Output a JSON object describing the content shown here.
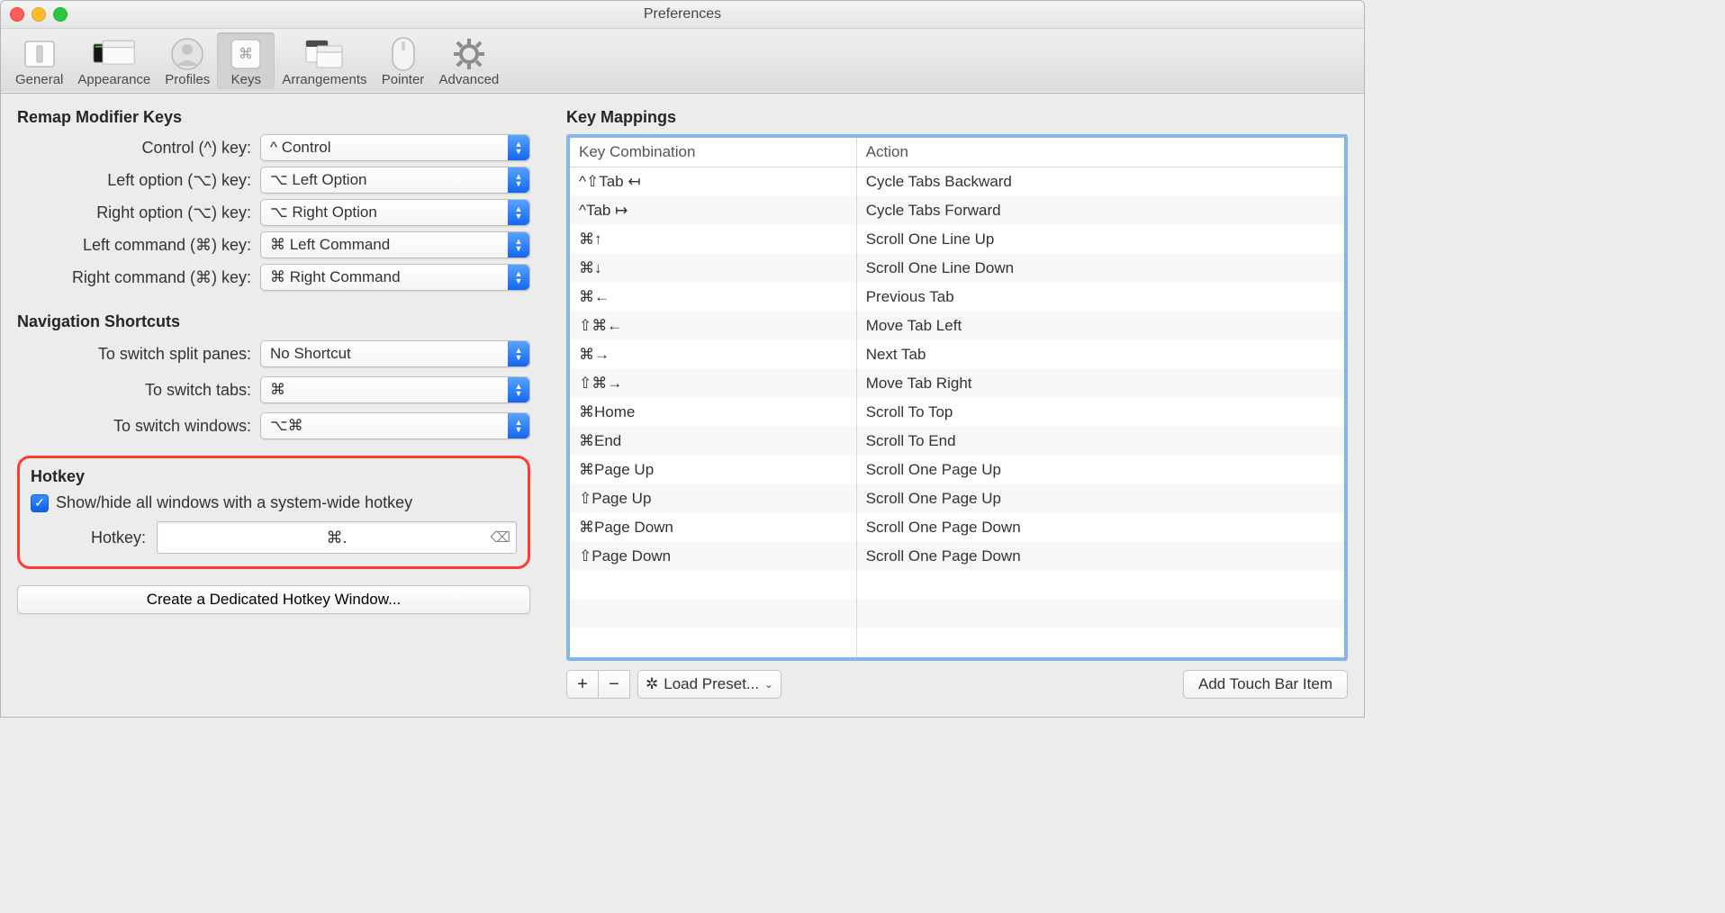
{
  "window": {
    "title": "Preferences"
  },
  "toolbar": {
    "items": [
      {
        "label": "General"
      },
      {
        "label": "Appearance"
      },
      {
        "label": "Profiles"
      },
      {
        "label": "Keys"
      },
      {
        "label": "Arrangements"
      },
      {
        "label": "Pointer"
      },
      {
        "label": "Advanced"
      }
    ],
    "selected_index": 3
  },
  "remap": {
    "title": "Remap Modifier Keys",
    "rows": [
      {
        "label": "Control (^) key:",
        "value": "^ Control"
      },
      {
        "label": "Left option (⌥) key:",
        "value": "⌥ Left Option"
      },
      {
        "label": "Right option (⌥) key:",
        "value": "⌥ Right Option"
      },
      {
        "label": "Left command (⌘) key:",
        "value": "⌘ Left Command"
      },
      {
        "label": "Right command (⌘) key:",
        "value": "⌘ Right Command"
      }
    ]
  },
  "nav": {
    "title": "Navigation Shortcuts",
    "rows": [
      {
        "label": "To switch split panes:",
        "value": "No Shortcut"
      },
      {
        "label": "To switch tabs:",
        "value": "⌘"
      },
      {
        "label": "To switch windows:",
        "value": "⌥⌘"
      }
    ]
  },
  "hotkey": {
    "title": "Hotkey",
    "checkbox_label": "Show/hide all windows with a system-wide hotkey",
    "checkbox_checked": true,
    "field_label": "Hotkey:",
    "field_value": "⌘.",
    "dedicated_button": "Create a Dedicated Hotkey Window..."
  },
  "key_mappings": {
    "title": "Key Mappings",
    "columns": [
      "Key Combination",
      "Action"
    ],
    "rows": [
      {
        "combo": "^⇧Tab ↤",
        "action": "Cycle Tabs Backward"
      },
      {
        "combo": "^Tab ↦",
        "action": "Cycle Tabs Forward"
      },
      {
        "combo": "⌘↑",
        "action": "Scroll One Line Up"
      },
      {
        "combo": "⌘↓",
        "action": "Scroll One Line Down"
      },
      {
        "combo": "⌘←",
        "action": "Previous Tab"
      },
      {
        "combo": "⇧⌘←",
        "action": "Move Tab Left"
      },
      {
        "combo": "⌘→",
        "action": "Next Tab"
      },
      {
        "combo": "⇧⌘→",
        "action": "Move Tab Right"
      },
      {
        "combo": "⌘Home",
        "action": "Scroll To Top"
      },
      {
        "combo": "⌘End",
        "action": "Scroll To End"
      },
      {
        "combo": "⌘Page Up",
        "action": "Scroll One Page Up"
      },
      {
        "combo": "⇧Page Up",
        "action": "Scroll One Page Up"
      },
      {
        "combo": "⌘Page Down",
        "action": "Scroll One Page Down"
      },
      {
        "combo": "⇧Page Down",
        "action": "Scroll One Page Down"
      }
    ],
    "blank_rows": 3,
    "footer": {
      "add": "+",
      "remove": "−",
      "preset_label": "Load Preset...",
      "touch_bar_button": "Add Touch Bar Item"
    }
  }
}
